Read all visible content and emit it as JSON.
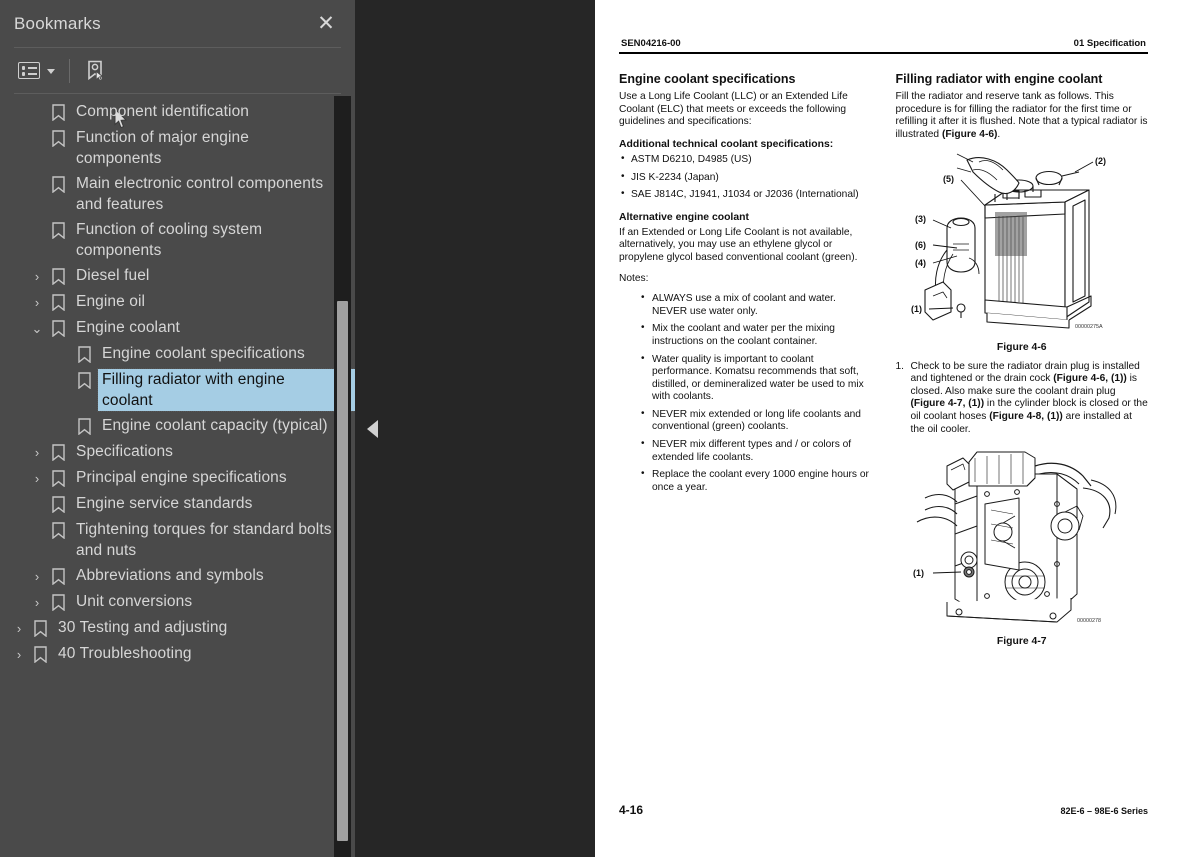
{
  "sidebar": {
    "title": "Bookmarks",
    "close_label": "✕",
    "toolbar": {
      "options_icon": "list-options-icon",
      "caret_icon": "chevron-down-icon",
      "find_bookmark_icon": "bookmark-pointer-icon"
    },
    "tree": [
      {
        "label": "Component identification",
        "depth": 1,
        "twisty": "",
        "selected": false
      },
      {
        "label": "Function of major engine components",
        "depth": 1,
        "twisty": "",
        "selected": false
      },
      {
        "label": "Main electronic control components and features",
        "depth": 1,
        "twisty": "",
        "selected": false
      },
      {
        "label": "Function of cooling system components",
        "depth": 1,
        "twisty": "",
        "selected": false
      },
      {
        "label": "Diesel fuel",
        "depth": 1,
        "twisty": "›",
        "selected": false
      },
      {
        "label": "Engine oil",
        "depth": 1,
        "twisty": "›",
        "selected": false
      },
      {
        "label": "Engine coolant",
        "depth": 1,
        "twisty": "⌄",
        "selected": false
      },
      {
        "label": "Engine coolant specifications",
        "depth": 2,
        "twisty": "",
        "selected": false
      },
      {
        "label": "Filling radiator with engine coolant",
        "depth": 2,
        "twisty": "",
        "selected": true
      },
      {
        "label": "Engine coolant capacity (typical)",
        "depth": 2,
        "twisty": "",
        "selected": false
      },
      {
        "label": "Specifications",
        "depth": 1,
        "twisty": "›",
        "selected": false
      },
      {
        "label": "Principal engine specifications",
        "depth": 1,
        "twisty": "›",
        "selected": false
      },
      {
        "label": "Engine service standards",
        "depth": 1,
        "twisty": "",
        "selected": false
      },
      {
        "label": "Tightening torques for standard bolts and nuts",
        "depth": 1,
        "twisty": "",
        "selected": false
      },
      {
        "label": "Abbreviations and symbols",
        "depth": 1,
        "twisty": "›",
        "selected": false
      },
      {
        "label": "Unit conversions",
        "depth": 1,
        "twisty": "›",
        "selected": false
      },
      {
        "label": "30 Testing and adjusting",
        "depth": 0,
        "twisty": "›",
        "selected": false
      },
      {
        "label": "40 Troubleshooting",
        "depth": 0,
        "twisty": "›",
        "selected": false
      }
    ]
  },
  "viewer": {
    "collapse_handle": "collapse-sidebar-handle"
  },
  "document": {
    "header_left": "SEN04216-00",
    "header_right": "01 Specification",
    "left_column": {
      "heading": "Engine coolant specifications",
      "intro": "Use a Long Life Coolant (LLC) or an Extended Life Coolant (ELC) that meets or exceeds the following guidelines and specifications:",
      "spec_heading": "Additional technical coolant specifications:",
      "spec_items": [
        "ASTM D6210, D4985 (US)",
        "JIS K-2234 (Japan)",
        "SAE J814C, J1941, J1034 or J2036 (International)"
      ],
      "alt_heading": "Alternative engine coolant",
      "alt_body": "If an Extended or Long Life Coolant is not available, alternatively, you may use an ethylene glycol or propylene glycol based conventional coolant (green).",
      "notes_label": "Notes:",
      "notes": [
        "ALWAYS use a mix of coolant and water. NEVER use water only.",
        "Mix the coolant and water per the mixing instructions on the coolant container.",
        "Water quality is important to coolant performance. Komatsu recommends that soft, distilled, or demineralized water be used to mix with coolants.",
        "NEVER mix extended or long life coolants and conventional (green) coolants.",
        "NEVER mix different types and / or colors of extended life coolants.",
        "Replace the coolant every 1000 engine hours or once a year."
      ]
    },
    "right_column": {
      "heading": "Filling radiator with engine coolant",
      "intro_a": "Fill the radiator and reserve tank as follows. This procedure is for filling the radiator for the first time or refilling it after it is flushed. Note that a typical radiator is illustrated ",
      "intro_b": "(Figure 4-6)",
      "intro_c": ".",
      "figure_46": {
        "caption": "Figure 4-6",
        "id": "00000275A",
        "callouts": [
          "(1)",
          "(2)",
          "(3)",
          "(4)",
          "(5)",
          "(6)"
        ]
      },
      "step1_num": "1.",
      "step1_a": "Check to be sure the radiator drain plug is installed and tightened or the drain cock ",
      "step1_b": "(Figure 4-6, (1))",
      "step1_c": " is closed. Also make sure the coolant drain plug ",
      "step1_d": "(Figure 4-7, (1))",
      "step1_e": " in the cylinder block is closed or the oil coolant hoses ",
      "step1_f": "(Figure 4-8, (1))",
      "step1_g": " are installed at the oil cooler.",
      "figure_47": {
        "caption": "Figure 4-7",
        "id": "00000278",
        "callouts": [
          "(1)"
        ]
      }
    },
    "footer_page": "4-16",
    "footer_series": "82E-6 – 98E-6 Series"
  },
  "colors": {
    "sidebar_bg": "#4a4a4a",
    "viewer_bg": "#262626",
    "selection": "#a5cde4",
    "text_light": "#d6d6d6",
    "scroll_track": "#1e1e1e",
    "scroll_thumb": "#a0a0a0"
  }
}
